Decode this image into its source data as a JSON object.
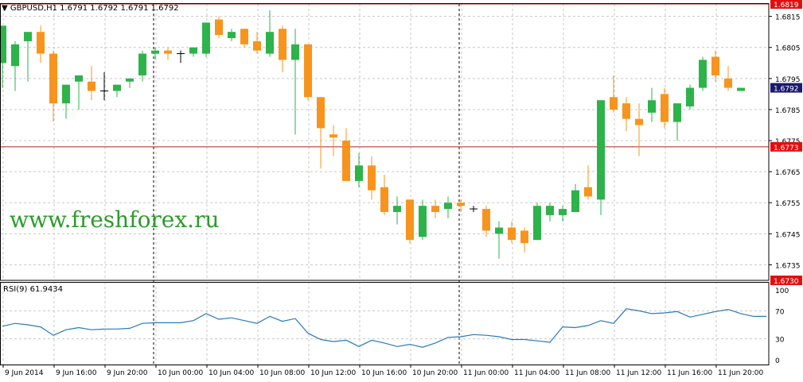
{
  "symbol_header": "GBPUSD,H1  1.6791 1.6792 1.6791 1.6792",
  "watermark": "www.freshforex.ru",
  "rsi_label": "RSI(9) 61.9434",
  "colors": {
    "bull": "#2db34a",
    "bear": "#f7941d",
    "grid": "#c8c8c8",
    "level_line": "#b22222",
    "rsi_line": "#2a7ab8",
    "price_tag": "#1a1a6e",
    "red_tag": "#e01010",
    "watermark": "#2e9a2e"
  },
  "price_axis": {
    "ticks": [
      "1.6815",
      "1.6805",
      "1.6795",
      "1.6785",
      "1.6775",
      "1.6765",
      "1.6755",
      "1.6745",
      "1.6735"
    ],
    "tag_top": "1.6819",
    "tag_current": "1.6792",
    "tag_level": "1.6773",
    "tag_bottom": "1.6730"
  },
  "rsi_axis": {
    "ticks": [
      "100",
      "70",
      "30",
      "0"
    ]
  },
  "time_axis": {
    "labels": [
      "9 Jun 2014",
      "9 Jun 16:00",
      "9 Jun 20:00",
      "10 Jun 00:00",
      "10 Jun 04:00",
      "10 Jun 08:00",
      "10 Jun 12:00",
      "10 Jun 16:00",
      "10 Jun 20:00",
      "11 Jun 00:00",
      "11 Jun 04:00",
      "11 Jun 08:00",
      "11 Jun 12:00",
      "11 Jun 16:00",
      "11 Jun 20:00"
    ]
  },
  "chart_data": [
    {
      "type": "candlestick",
      "title": "GBPUSD,H1",
      "ylim": [
        1.673,
        1.6819
      ],
      "horizontal_lines": [
        1.6819,
        1.6773,
        1.673
      ],
      "candles": [
        {
          "o": 1.68,
          "h": 1.6812,
          "l": 1.6792,
          "c": 1.6812
        },
        {
          "o": 1.6799,
          "h": 1.6807,
          "l": 1.6791,
          "c": 1.6806
        },
        {
          "o": 1.6807,
          "h": 1.681,
          "l": 1.6794,
          "c": 1.681
        },
        {
          "o": 1.681,
          "h": 1.6812,
          "l": 1.68,
          "c": 1.6803
        },
        {
          "o": 1.6803,
          "h": 1.6804,
          "l": 1.6781,
          "c": 1.6787
        },
        {
          "o": 1.6787,
          "h": 1.6793,
          "l": 1.6782,
          "c": 1.6793
        },
        {
          "o": 1.6794,
          "h": 1.6796,
          "l": 1.6785,
          "c": 1.6796
        },
        {
          "o": 1.6794,
          "h": 1.6799,
          "l": 1.6788,
          "c": 1.6791
        },
        {
          "o": 1.6791,
          "h": 1.6797,
          "l": 1.6788,
          "c": 1.6791
        },
        {
          "o": 1.6791,
          "h": 1.6793,
          "l": 1.6789,
          "c": 1.6793
        },
        {
          "o": 1.6794,
          "h": 1.6795,
          "l": 1.6792,
          "c": 1.6795
        },
        {
          "o": 1.6796,
          "h": 1.6804,
          "l": 1.6794,
          "c": 1.6803
        },
        {
          "o": 1.6803,
          "h": 1.6805,
          "l": 1.6801,
          "c": 1.6804
        },
        {
          "o": 1.6804,
          "h": 1.6805,
          "l": 1.6801,
          "c": 1.6803
        },
        {
          "o": 1.6803,
          "h": 1.6804,
          "l": 1.68,
          "c": 1.6803
        },
        {
          "o": 1.6803,
          "h": 1.6805,
          "l": 1.6802,
          "c": 1.6805
        },
        {
          "o": 1.6803,
          "h": 1.6813,
          "l": 1.6802,
          "c": 1.6813
        },
        {
          "o": 1.6814,
          "h": 1.6815,
          "l": 1.6808,
          "c": 1.6809
        },
        {
          "o": 1.6808,
          "h": 1.6811,
          "l": 1.6807,
          "c": 1.681
        },
        {
          "o": 1.6811,
          "h": 1.6811,
          "l": 1.6805,
          "c": 1.6806
        },
        {
          "o": 1.6807,
          "h": 1.681,
          "l": 1.6803,
          "c": 1.6804
        },
        {
          "o": 1.6803,
          "h": 1.6817,
          "l": 1.6802,
          "c": 1.681
        },
        {
          "o": 1.6811,
          "h": 1.6812,
          "l": 1.6797,
          "c": 1.6801
        },
        {
          "o": 1.6801,
          "h": 1.6811,
          "l": 1.6777,
          "c": 1.6806
        },
        {
          "o": 1.6806,
          "h": 1.6806,
          "l": 1.6788,
          "c": 1.6789
        },
        {
          "o": 1.6789,
          "h": 1.6789,
          "l": 1.6766,
          "c": 1.6779
        },
        {
          "o": 1.6777,
          "h": 1.678,
          "l": 1.677,
          "c": 1.6776
        },
        {
          "o": 1.6775,
          "h": 1.6779,
          "l": 1.6762,
          "c": 1.6762
        },
        {
          "o": 1.6762,
          "h": 1.6771,
          "l": 1.676,
          "c": 1.6767
        },
        {
          "o": 1.6767,
          "h": 1.677,
          "l": 1.6756,
          "c": 1.6759
        },
        {
          "o": 1.676,
          "h": 1.6764,
          "l": 1.6751,
          "c": 1.6752
        },
        {
          "o": 1.6752,
          "h": 1.6757,
          "l": 1.6748,
          "c": 1.6754
        },
        {
          "o": 1.6756,
          "h": 1.6756,
          "l": 1.6742,
          "c": 1.6743
        },
        {
          "o": 1.6744,
          "h": 1.6756,
          "l": 1.6743,
          "c": 1.6754
        },
        {
          "o": 1.6754,
          "h": 1.6756,
          "l": 1.675,
          "c": 1.6752
        },
        {
          "o": 1.6753,
          "h": 1.6757,
          "l": 1.675,
          "c": 1.6755
        },
        {
          "o": 1.6755,
          "h": 1.6756,
          "l": 1.6752,
          "c": 1.6754
        },
        {
          "o": 1.6753,
          "h": 1.6754,
          "l": 1.6752,
          "c": 1.6753
        },
        {
          "o": 1.6753,
          "h": 1.6754,
          "l": 1.6744,
          "c": 1.6746
        },
        {
          "o": 1.6745,
          "h": 1.6749,
          "l": 1.6737,
          "c": 1.6747
        },
        {
          "o": 1.6747,
          "h": 1.6749,
          "l": 1.6742,
          "c": 1.6743
        },
        {
          "o": 1.6746,
          "h": 1.6747,
          "l": 1.6739,
          "c": 1.6742
        },
        {
          "o": 1.6743,
          "h": 1.6755,
          "l": 1.6743,
          "c": 1.6754
        },
        {
          "o": 1.6751,
          "h": 1.6755,
          "l": 1.6749,
          "c": 1.6754
        },
        {
          "o": 1.6751,
          "h": 1.6754,
          "l": 1.6749,
          "c": 1.6753
        },
        {
          "o": 1.6752,
          "h": 1.6761,
          "l": 1.6752,
          "c": 1.6759
        },
        {
          "o": 1.676,
          "h": 1.6767,
          "l": 1.6756,
          "c": 1.6757
        },
        {
          "o": 1.6756,
          "h": 1.6788,
          "l": 1.6751,
          "c": 1.6788
        },
        {
          "o": 1.6789,
          "h": 1.6796,
          "l": 1.6784,
          "c": 1.6785
        },
        {
          "o": 1.6787,
          "h": 1.6789,
          "l": 1.6778,
          "c": 1.6782
        },
        {
          "o": 1.6782,
          "h": 1.6787,
          "l": 1.677,
          "c": 1.678
        },
        {
          "o": 1.6784,
          "h": 1.6792,
          "l": 1.6781,
          "c": 1.6788
        },
        {
          "o": 1.679,
          "h": 1.6792,
          "l": 1.6779,
          "c": 1.6781
        },
        {
          "o": 1.6781,
          "h": 1.6787,
          "l": 1.6775,
          "c": 1.6787
        },
        {
          "o": 1.6786,
          "h": 1.6793,
          "l": 1.6785,
          "c": 1.6792
        },
        {
          "o": 1.6792,
          "h": 1.6802,
          "l": 1.6791,
          "c": 1.6801
        },
        {
          "o": 1.6802,
          "h": 1.6804,
          "l": 1.6794,
          "c": 1.6796
        },
        {
          "o": 1.6795,
          "h": 1.6799,
          "l": 1.6791,
          "c": 1.6792
        },
        {
          "o": 1.6791,
          "h": 1.6792,
          "l": 1.6791,
          "c": 1.6792
        }
      ]
    },
    {
      "type": "line",
      "title": "RSI(9) 61.9434",
      "ylim": [
        0,
        100
      ],
      "levels": [
        70,
        30
      ],
      "series": [
        {
          "values": [
            48,
            52,
            50,
            47,
            35,
            43,
            46,
            43,
            44,
            44,
            45,
            52,
            53,
            53,
            53,
            56,
            66,
            58,
            60,
            56,
            52,
            62,
            55,
            59,
            38,
            29,
            26,
            28,
            19,
            28,
            24,
            19,
            22,
            18,
            24,
            32,
            33,
            36,
            35,
            33,
            29,
            29,
            27,
            25,
            47,
            46,
            49,
            56,
            52,
            73,
            70,
            66,
            67,
            69,
            61,
            65,
            69,
            72,
            66,
            62,
            62
          ]
        }
      ]
    }
  ]
}
